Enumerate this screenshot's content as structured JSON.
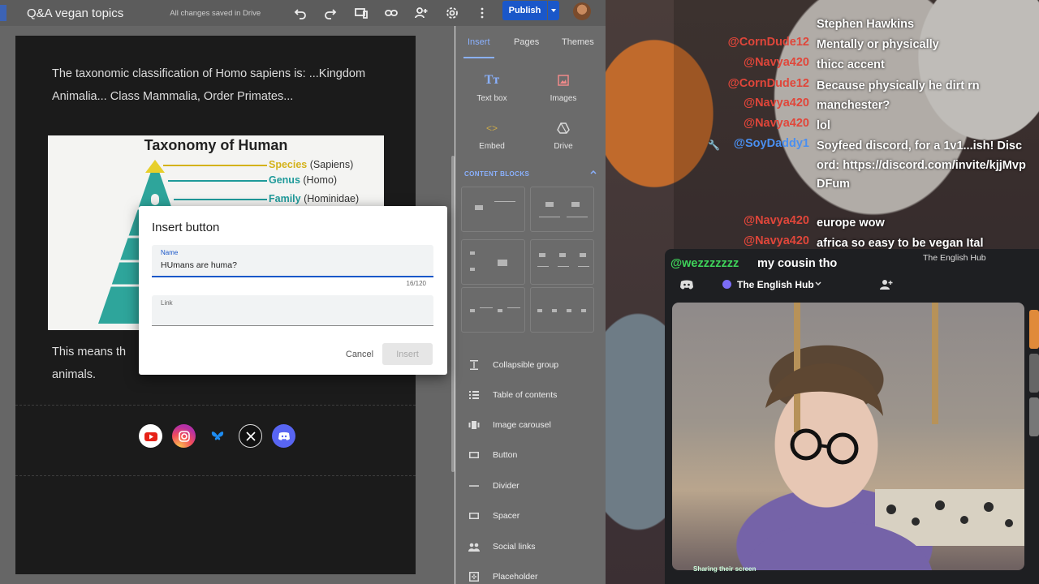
{
  "sites": {
    "doc_title": "Q&A vegan topics",
    "save_status": "All changes saved in Drive",
    "publish_label": "Publish",
    "page": {
      "paragraph1": "The taxonomic classification of Homo sapiens is: ...Kingdom Animalia... Class Mammalia, Order Primates...",
      "image": {
        "title": "Taxonomy of Human",
        "rows": [
          {
            "rank": "Species",
            "value": "(Sapiens)",
            "color": "#d4b21a"
          },
          {
            "rank": "Genus",
            "value": "(Homo)",
            "color": "#1f9a9a"
          },
          {
            "rank": "Family",
            "value": "(Hominidae)",
            "color": "#1f9a9a"
          }
        ]
      },
      "paragraph2_start": "This means th",
      "paragraph2_end": "animals.",
      "social_icons": [
        "youtube-icon",
        "instagram-icon",
        "bluesky-icon",
        "x-icon",
        "discord-icon"
      ]
    },
    "panel": {
      "tabs": [
        "Insert",
        "Pages",
        "Themes"
      ],
      "active_tab": "Insert",
      "grid": [
        {
          "label": "Text box",
          "icon": "text-box-icon"
        },
        {
          "label": "Images",
          "icon": "image-icon"
        },
        {
          "label": "Embed",
          "icon": "embed-icon"
        },
        {
          "label": "Drive",
          "icon": "drive-icon"
        }
      ],
      "section_title": "CONTENT BLOCKS",
      "list": [
        {
          "label": "Collapsible group",
          "icon": "collapsible-icon"
        },
        {
          "label": "Table of contents",
          "icon": "toc-icon"
        },
        {
          "label": "Image carousel",
          "icon": "carousel-icon"
        },
        {
          "label": "Button",
          "icon": "button-icon"
        },
        {
          "label": "Divider",
          "icon": "divider-icon"
        },
        {
          "label": "Spacer",
          "icon": "spacer-icon"
        },
        {
          "label": "Social links",
          "icon": "social-links-icon"
        },
        {
          "label": "Placeholder",
          "icon": "placeholder-icon"
        }
      ]
    },
    "dialog": {
      "title": "Insert button",
      "name_label": "Name",
      "name_value": "HUmans are huma?",
      "counter": "16/120",
      "link_label": "Link",
      "link_value": "",
      "cancel_label": "Cancel",
      "insert_label": "Insert"
    }
  },
  "stream": {
    "chat": [
      {
        "user": "",
        "message": "Stephen Hawkins",
        "color": "#ffffff"
      },
      {
        "user": "@CornDude12",
        "message": "Mentally or physically",
        "color": "#e0463a"
      },
      {
        "user": "@Navya420",
        "message": "thicc accent",
        "color": "#e0463a"
      },
      {
        "user": "@CornDude12",
        "message": "Because physically he dirt rn",
        "color": "#e0463a"
      },
      {
        "user": "@Navya420",
        "message": "manchester?",
        "color": "#e0463a"
      },
      {
        "user": "@Navya420",
        "message": "lol",
        "color": "#e0463a"
      },
      {
        "user": "@SoyDaddy1",
        "message": "Soyfeed discord, for a 1v1...ish! Discord: https://discord.com/invite/kjjMvpDFum",
        "color": "#4a8ff0"
      },
      {
        "user": "@Navya420",
        "message": "europe wow",
        "color": "#e0463a"
      },
      {
        "user": "@Navya420",
        "message": "africa so easy to be vegan Ital",
        "color": "#e0463a"
      },
      {
        "user": "@wezzzzzzz",
        "message": "my cousin tho",
        "color": "#3fd35a"
      }
    ],
    "discord": {
      "top_label": "The English Hub",
      "server_name": "The English Hub",
      "sharing_text": "Sharing their screen"
    }
  }
}
